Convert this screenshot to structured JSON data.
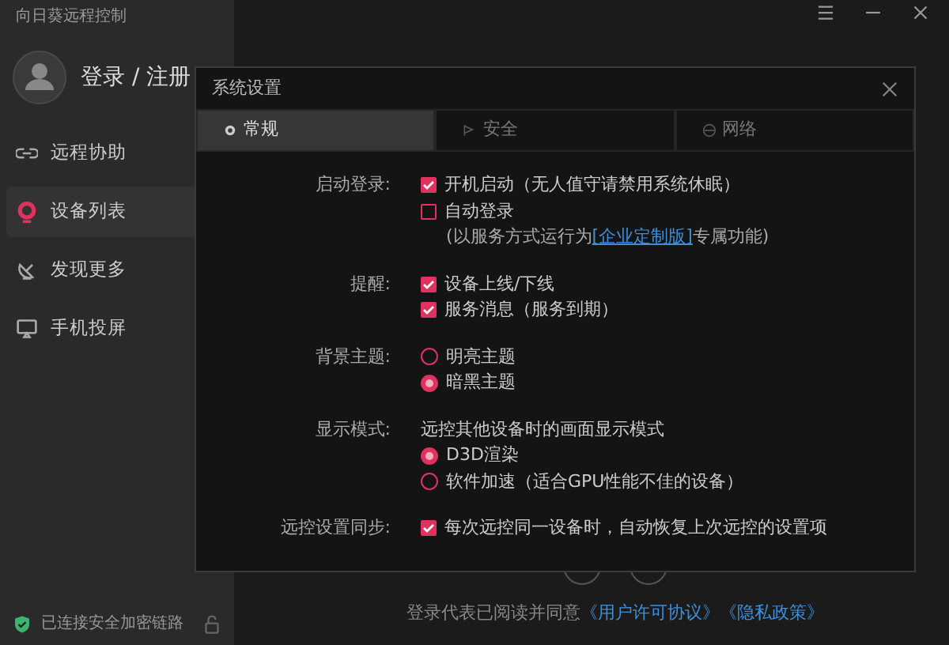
{
  "app": {
    "title": "向日葵远程控制",
    "user": "登录 / 注册",
    "nav": [
      {
        "label": "远程协助",
        "kind": "link",
        "selected": false
      },
      {
        "label": "设备列表",
        "kind": "pin",
        "selected": true
      },
      {
        "label": "发现更多",
        "kind": "dish",
        "selected": false
      },
      {
        "label": "手机投屏",
        "kind": "screen",
        "selected": false
      }
    ],
    "status": "已连接安全加密链路"
  },
  "footer": {
    "text": "登录代表已阅读并同意",
    "links": [
      "《用户许可协议》",
      "《隐私政策》"
    ]
  },
  "dialog": {
    "title": "系统设置",
    "tabs": [
      {
        "label": "常规",
        "kind": "gear",
        "selected": true
      },
      {
        "label": "安全",
        "kind": "flag",
        "selected": false
      },
      {
        "label": "网络",
        "kind": "globe",
        "selected": false
      }
    ],
    "sections": [
      {
        "label": "启动登录:",
        "items": [
          {
            "kind": "checkbox",
            "text": "开机启动（无人值守请禁用系统休眠）",
            "checked": true
          },
          {
            "kind": "checkbox",
            "text": "自动登录",
            "checked": false
          },
          {
            "kind": "note",
            "text": "(以服务方式运行为",
            "link": "[企业定制版]",
            "after": "专属功能)"
          }
        ]
      },
      {
        "label": "提醒:",
        "items": [
          {
            "kind": "checkbox",
            "text": "设备上线/下线",
            "checked": true
          },
          {
            "kind": "checkbox",
            "text": "服务消息（服务到期）",
            "checked": true
          }
        ]
      },
      {
        "label": "背景主题:",
        "items": [
          {
            "kind": "radio",
            "text": "明亮主题",
            "selected": false
          },
          {
            "kind": "radio",
            "text": "暗黑主题",
            "selected": true
          }
        ]
      },
      {
        "label": "显示模式:",
        "items": [
          {
            "kind": "text",
            "text": "远控其他设备时的画面显示模式"
          },
          {
            "kind": "radio",
            "text": "D3D渲染",
            "selected": true
          },
          {
            "kind": "radio",
            "text": "软件加速（适合GPU性能不佳的设备）",
            "selected": false
          }
        ]
      },
      {
        "label": "远控设置同步:",
        "items": [
          {
            "kind": "checkbox",
            "text": "每次远控同一设备时，自动恢复上次远控的设置项",
            "checked": true
          }
        ]
      }
    ]
  }
}
